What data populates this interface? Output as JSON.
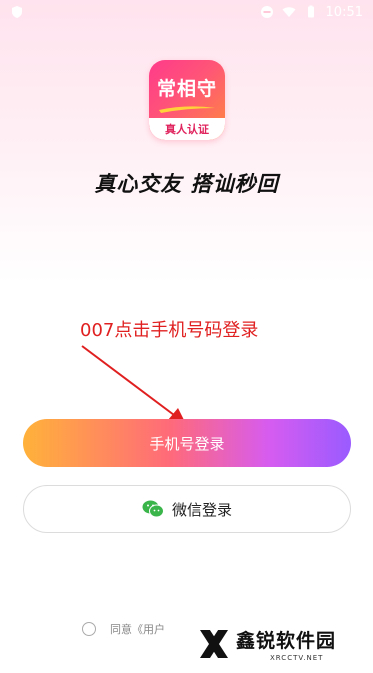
{
  "status_bar": {
    "time": "10:51",
    "icons": [
      "shield-icon",
      "minus-circle-icon",
      "wifi-icon",
      "battery-icon"
    ]
  },
  "app_logo": {
    "title": "常相守",
    "badge": "真人认证",
    "colors": {
      "gradient_start": "#ff3a8a",
      "gradient_end": "#ff8a3c"
    }
  },
  "slogan": "真心交友 搭讪秒回",
  "annotation": {
    "text": "007点击手机号码登录",
    "color": "#e02020"
  },
  "buttons": {
    "phone_login": "手机号登录",
    "wechat_login": "微信登录"
  },
  "agreement": {
    "text": "同意《用户"
  },
  "watermark": {
    "brand": "鑫锐软件园",
    "domain": "XRCCTV.NET"
  }
}
